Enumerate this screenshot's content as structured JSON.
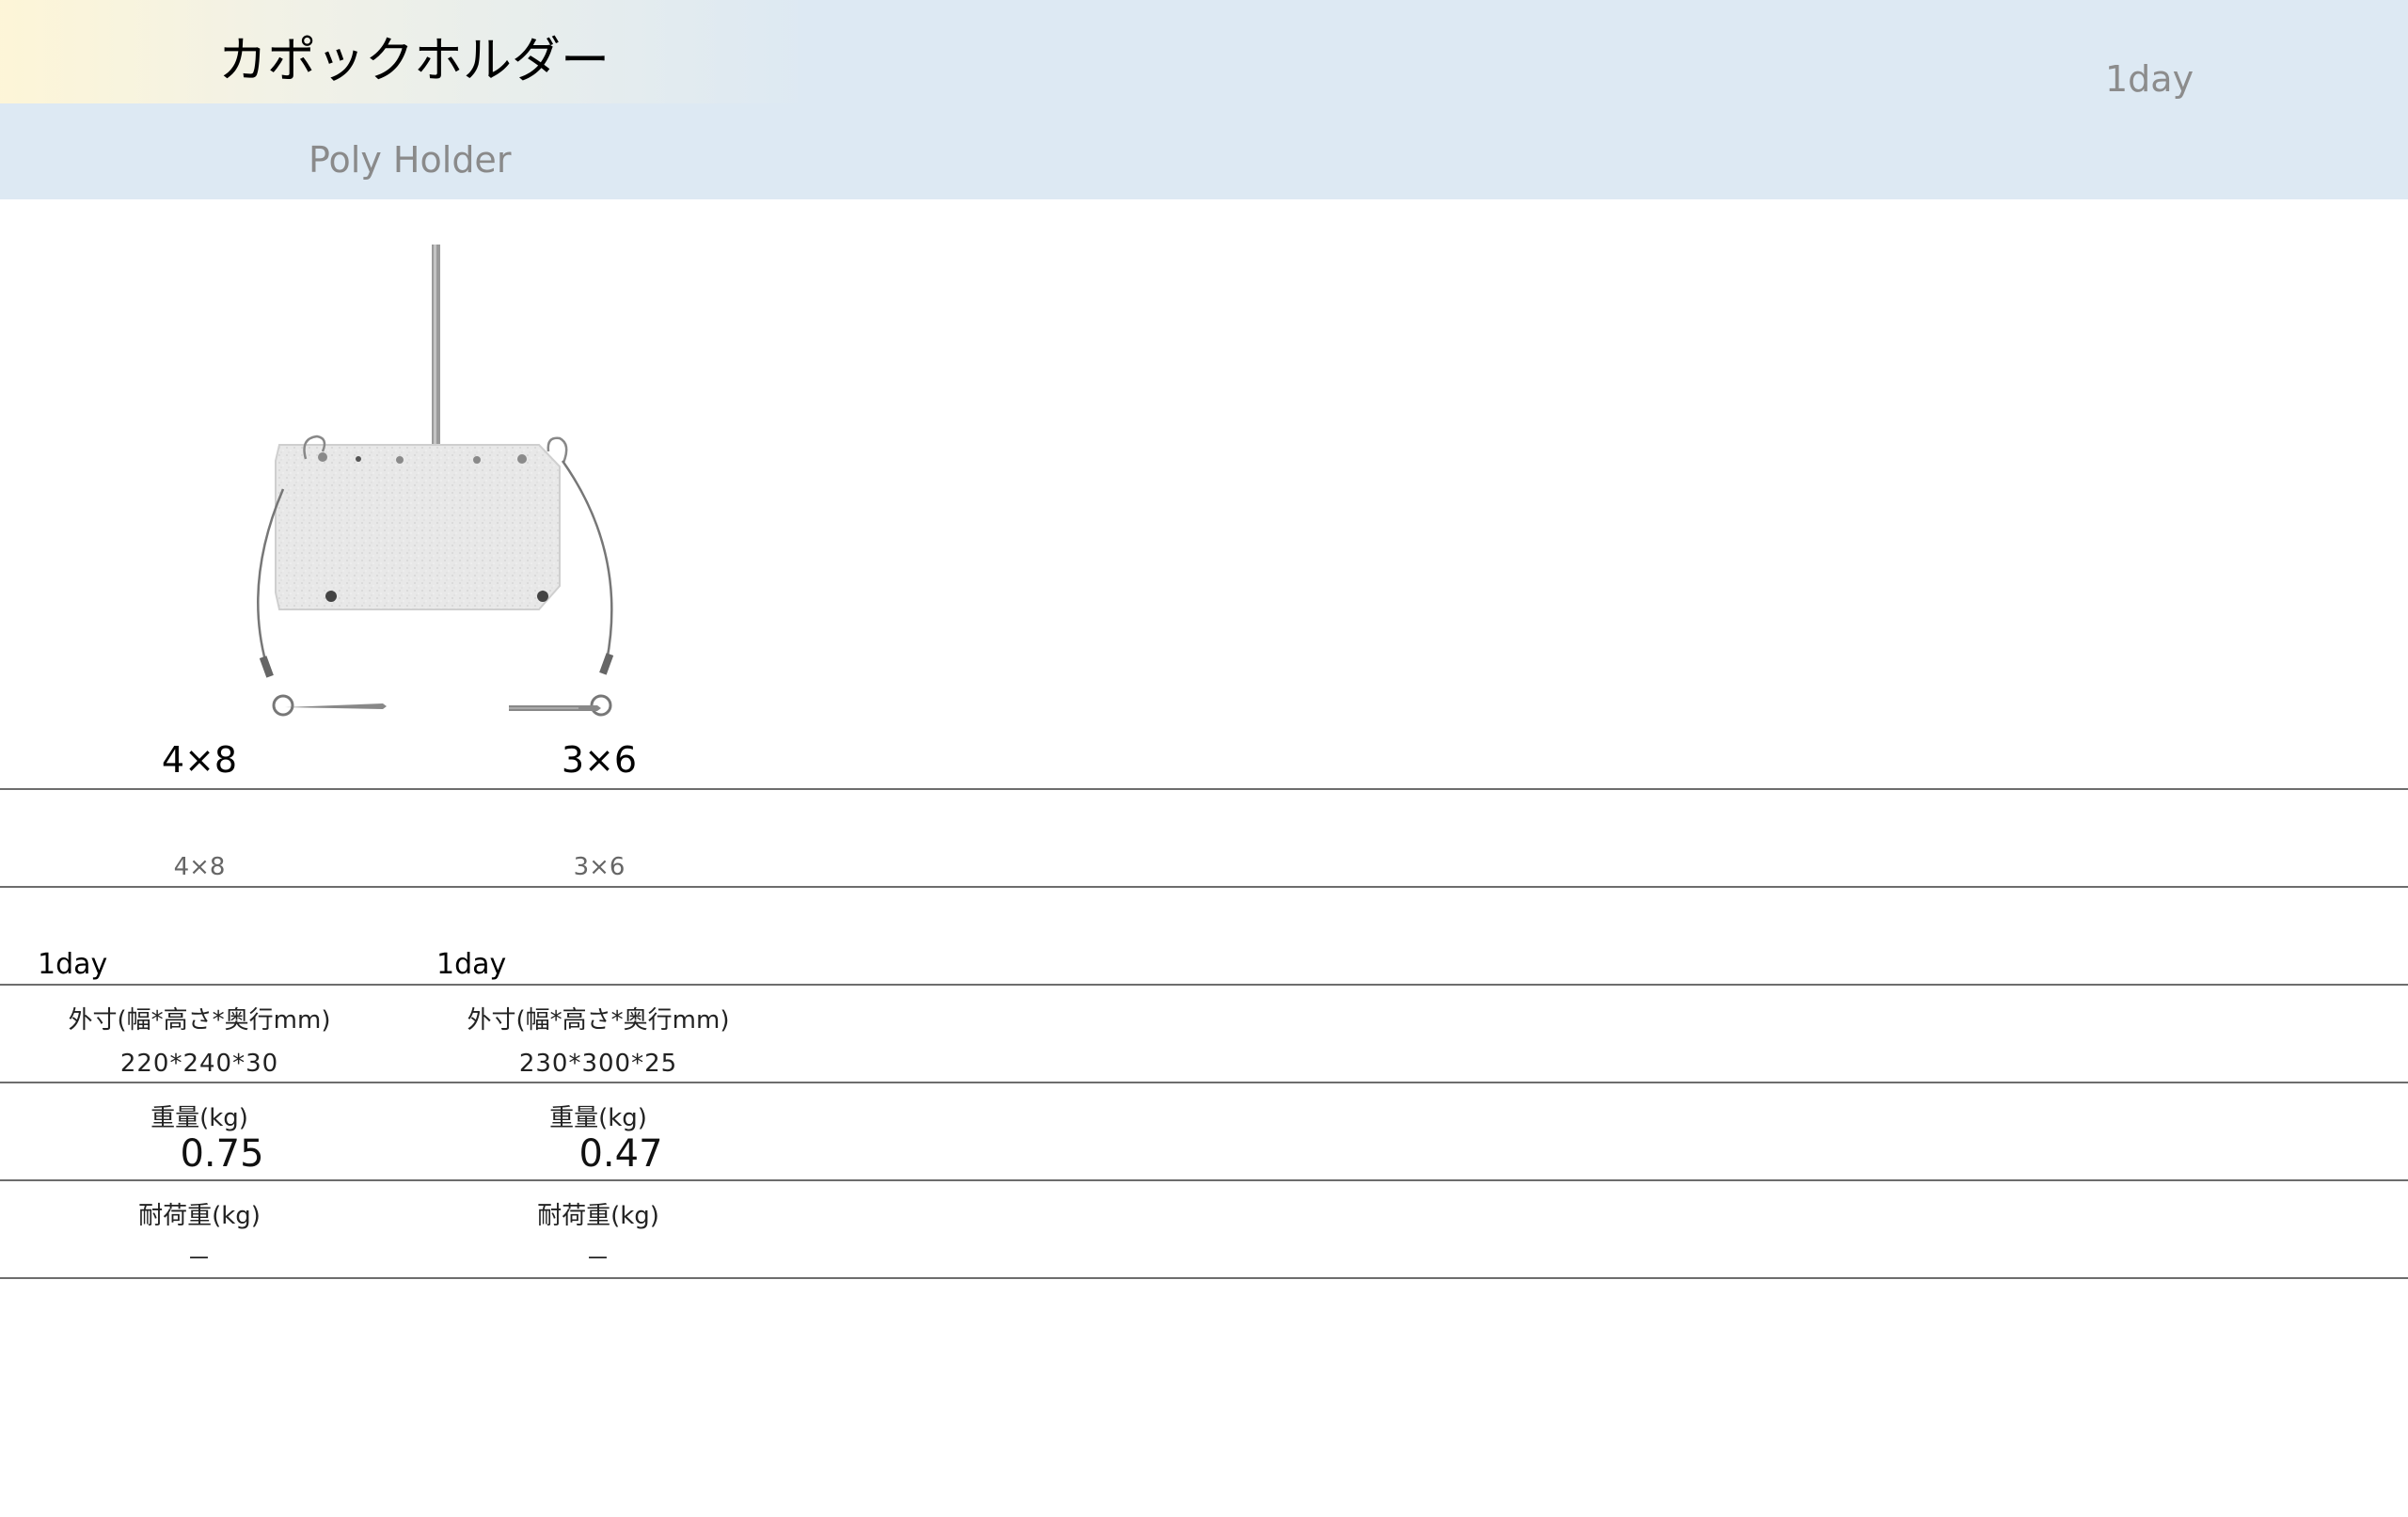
{
  "header": {
    "title": "カポックホルダー",
    "subtitle": "Poly Holder",
    "delivery": "1day"
  },
  "products": [
    {
      "size_label": "4×8",
      "size_label_small": "4×8",
      "delivery": "1day",
      "dims_label": "外寸(幅*高さ*奥行mm)",
      "dims_value": "220*240*30",
      "weight_label": "重量(kg)",
      "weight_value": "0.75",
      "load_label": "耐荷重(kg)",
      "load_value": "－"
    },
    {
      "size_label": "3×6",
      "size_label_small": "3×6",
      "delivery": "1day",
      "dims_label": "外寸(幅*高さ*奥行mm)",
      "dims_value": "230*300*25",
      "weight_label": "重量(kg)",
      "weight_value": "0.47",
      "load_label": "耐荷重(kg)",
      "load_value": "－"
    }
  ],
  "colors": {
    "header_bg": "#dde9f3",
    "rule": "#6d6d6d"
  }
}
